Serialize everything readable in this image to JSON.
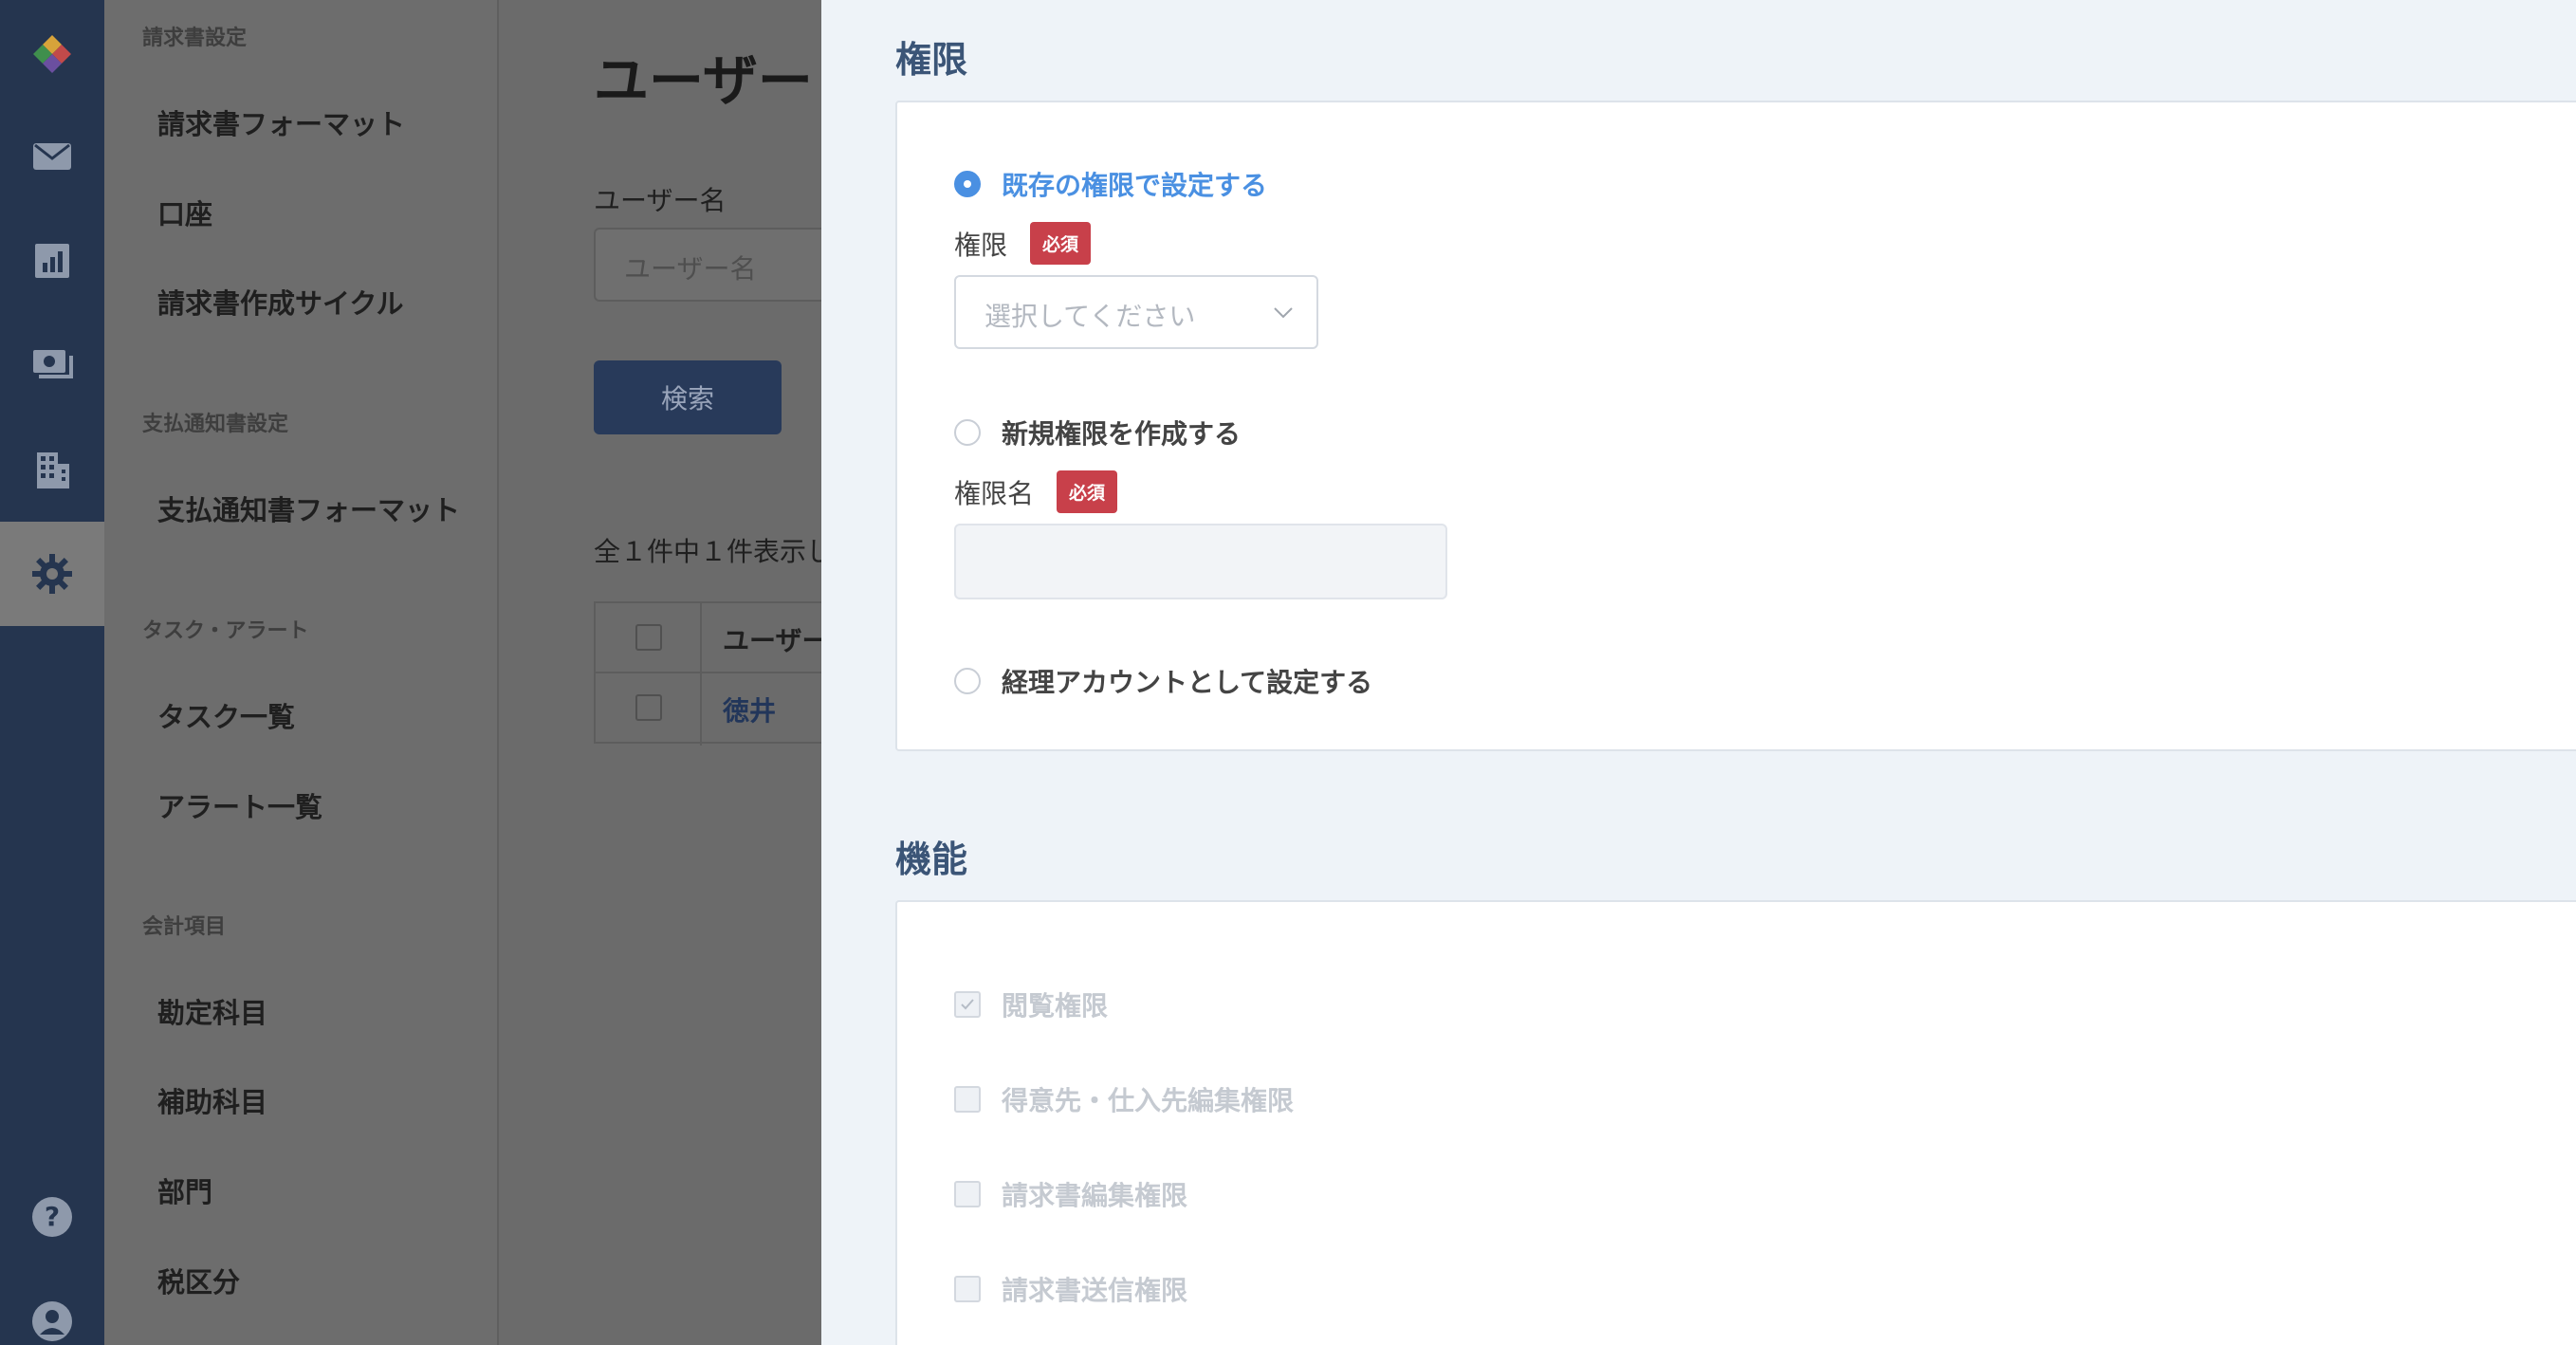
{
  "rail": {
    "items": [
      {
        "icon": "logo-icon"
      },
      {
        "icon": "mail-icon"
      },
      {
        "icon": "chart-icon"
      },
      {
        "icon": "payment-icon"
      },
      {
        "icon": "building-icon"
      },
      {
        "icon": "gear-icon",
        "active": true
      },
      {
        "icon": "help-icon"
      },
      {
        "icon": "account-icon"
      }
    ]
  },
  "menu": {
    "sections": [
      {
        "title": "請求書設定",
        "items": [
          "請求書フォーマット",
          "口座",
          "請求書作成サイクル"
        ]
      },
      {
        "title": "支払通知書設定",
        "items": [
          "支払通知書フォーマット"
        ]
      },
      {
        "title": "タスク・アラート",
        "items": [
          "タスク一覧",
          "アラート一覧"
        ]
      },
      {
        "title": "会計項目",
        "items": [
          "勘定科目",
          "補助科目",
          "部門",
          "税区分"
        ]
      }
    ]
  },
  "background_page": {
    "title": "ユーザー",
    "search_label": "ユーザー名",
    "search_placeholder": "ユーザー名",
    "search_button": "検索",
    "result_count": "全１件中１件表示し",
    "table": {
      "header": "ユーザー",
      "rows": [
        "徳井"
      ]
    }
  },
  "panel": {
    "permission": {
      "heading": "権限",
      "option_existing": "既存の権限で設定する",
      "permission_label": "権限",
      "required_badge": "必須",
      "select_placeholder": "選択してください",
      "option_new": "新規権限を作成する",
      "permission_name_label": "権限名",
      "option_accounting": "経理アカウントとして設定する",
      "selected_option": "既存の権限で設定する"
    },
    "features": {
      "heading": "機能",
      "items": [
        {
          "label": "閲覧権限",
          "checked": true
        },
        {
          "label": "得意先・仕入先編集権限",
          "checked": false
        },
        {
          "label": "請求書編集権限",
          "checked": false
        },
        {
          "label": "請求書送信権限",
          "checked": false
        }
      ]
    }
  },
  "colors": {
    "rail": "#25354f",
    "accent_blue": "#4a90e2",
    "required_red": "#c8404a",
    "heading_navy": "#3b5577"
  }
}
